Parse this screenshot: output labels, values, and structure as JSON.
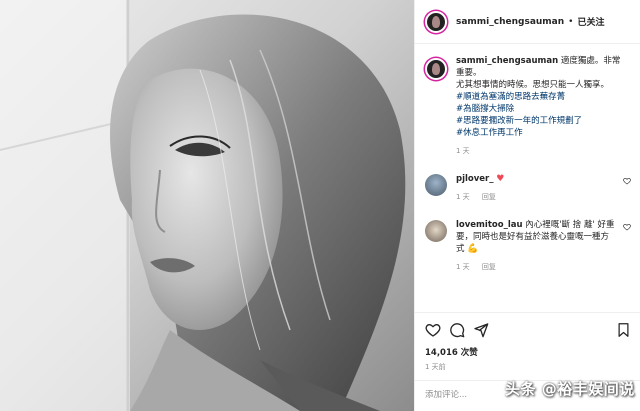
{
  "post": {
    "username": "sammi_chengsauman",
    "follow_status": "已关注",
    "separator": "•"
  },
  "caption": {
    "username": "sammi_chengsauman",
    "text_lines": [
      "適度獨處。非常重要。",
      "尤其想事情的時候。思想只能一人獨享。"
    ],
    "hashtags": [
      "#順道為塞滿的思路去蕪存菁",
      "#為腦撐大掃除",
      "#思路要擱改新一年的工作規劃了",
      "#休息工作再工作"
    ],
    "age": "1 天"
  },
  "comments": [
    {
      "username": "pjlover_",
      "text": "",
      "emoji_name": "red-heart-emoji",
      "age": "1 天",
      "reply": "回复"
    },
    {
      "username": "lovemitoo_lau",
      "text": "內心裡嘅'斷 捨 離' 好重要，同時也是好有益於滋養心靈嘅一種方式",
      "emoji_name": "flexed-biceps-emoji",
      "age": "1 天",
      "reply": "回复"
    }
  ],
  "engagement": {
    "likes": "14,016 次赞",
    "time": "1 天前"
  },
  "comment_input": {
    "placeholder": "添加评论..."
  },
  "watermark": "头条 @裕丰娱间说",
  "colors": {
    "link": "#00376b",
    "heart": "#ed4956",
    "meta": "#8e8e8e"
  }
}
